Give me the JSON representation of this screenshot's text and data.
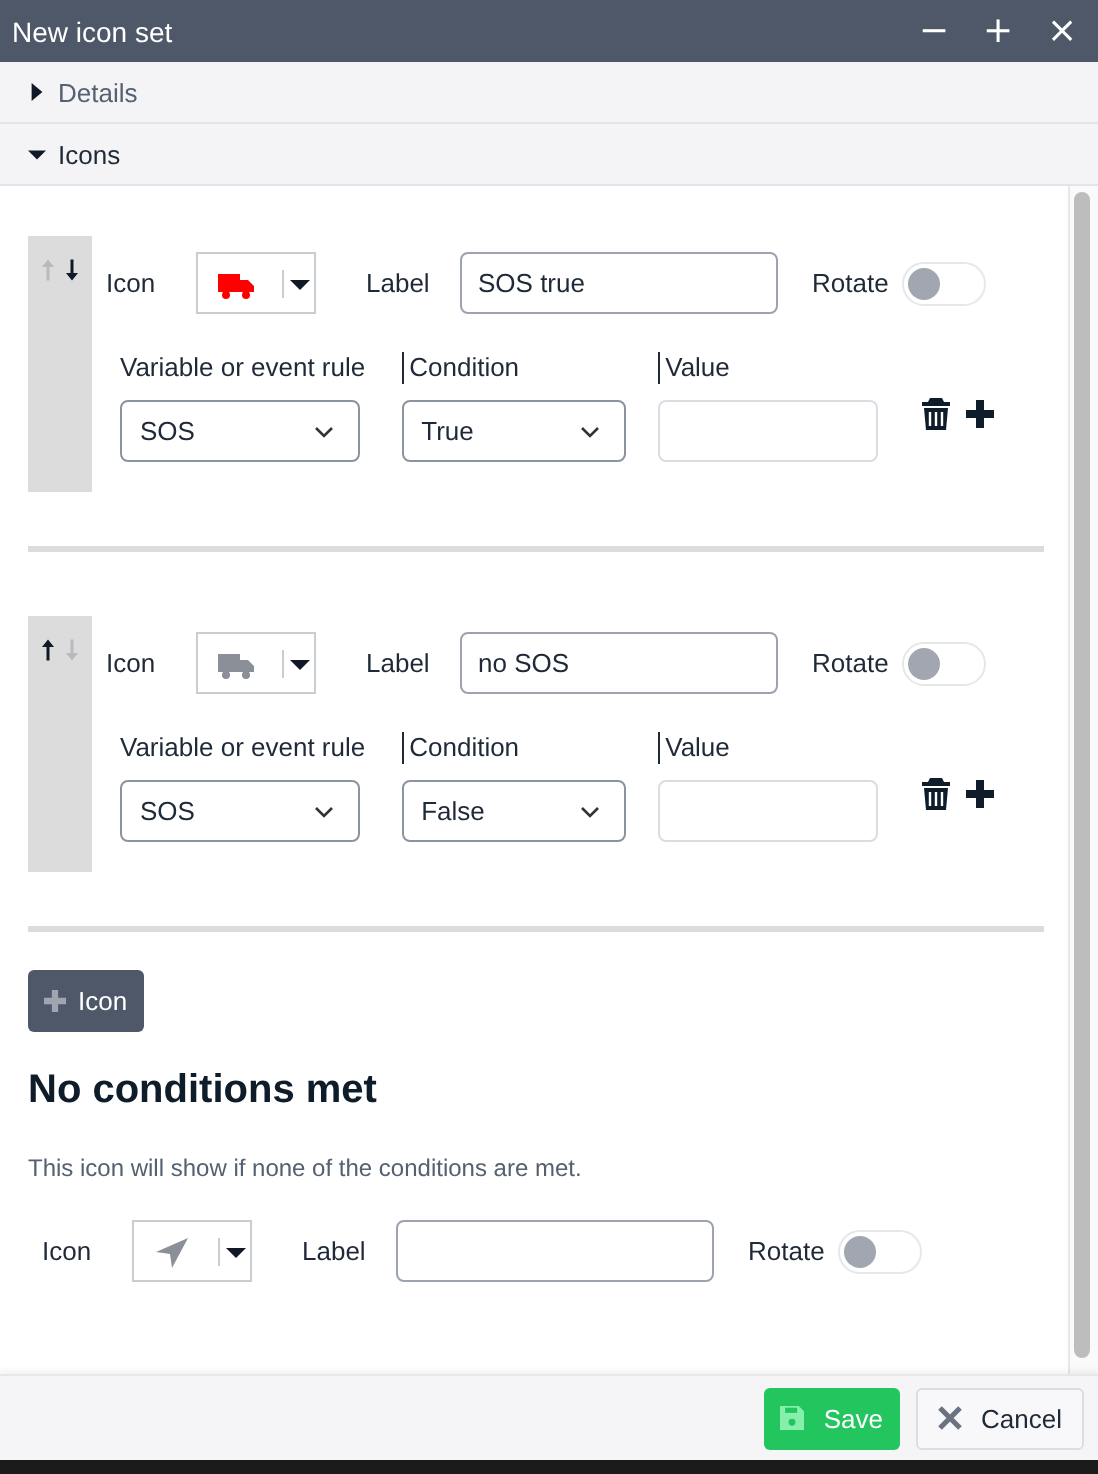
{
  "window": {
    "title": "New icon set",
    "controls": [
      "−",
      "+",
      "×"
    ]
  },
  "sections": [
    {
      "label": "Details",
      "expanded": false
    },
    {
      "label": "Icons",
      "expanded": true
    }
  ],
  "rules": [
    {
      "up_enabled": false,
      "down_enabled": true,
      "icon_label": "Icon",
      "color": "#ff0000",
      "label_caption": "Label",
      "label_value": "SOS true",
      "rotate_caption": "Rotate",
      "rotate_on": false,
      "variable_caption": "Variable or event rule",
      "variable": "SOS",
      "condition_caption": "Condition",
      "condition": "True",
      "value_caption": "Value"
    },
    {
      "up_enabled": true,
      "down_enabled": false,
      "icon_label": "Icon",
      "color": "#8a8f98",
      "label_caption": "Label",
      "label_value": "no SOS",
      "rotate_caption": "Rotate",
      "rotate_on": false,
      "variable_caption": "Variable or event rule",
      "variable": "SOS",
      "condition_caption": "Condition",
      "condition": "False",
      "value_caption": "Value"
    }
  ],
  "add_button": "Icon",
  "fallback": {
    "heading": "No conditions met",
    "description": "This icon will show if none of the conditions are met.",
    "icon_label": "Icon",
    "label_caption": "Label",
    "rotate_caption": "Rotate",
    "rotate_on": false
  },
  "footer": {
    "save": "Save",
    "cancel": "Cancel"
  }
}
